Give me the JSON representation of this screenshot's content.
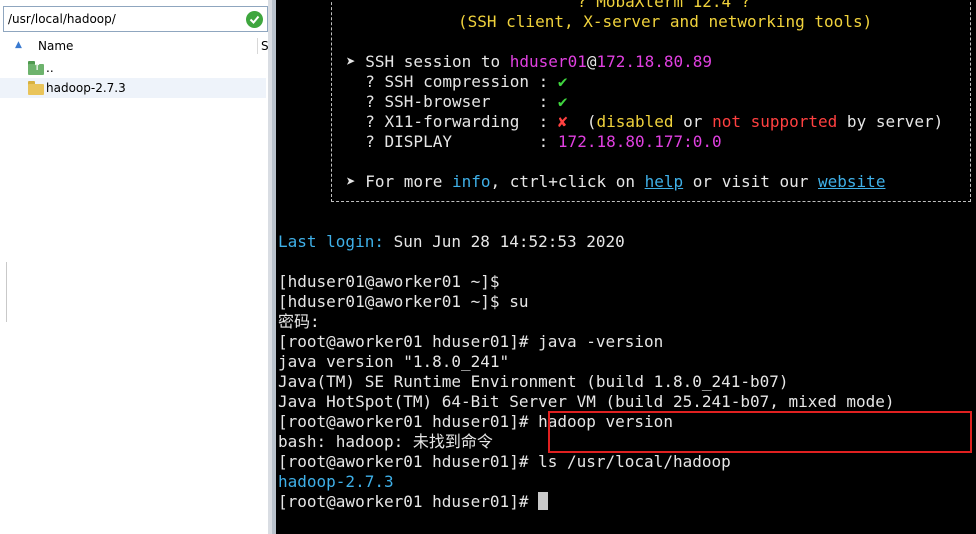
{
  "file_browser": {
    "path": "/usr/local/hadoop/",
    "columns": {
      "name": "Name",
      "size": "S"
    },
    "items": [
      {
        "name": "..",
        "icon": "parent-folder-icon"
      },
      {
        "name": "hadoop-2.7.3",
        "icon": "folder-icon"
      }
    ]
  },
  "terminal": {
    "banner": {
      "title": "? MobaXterm 12.4 ?",
      "subtitle": "(SSH client, X-server and networking tools)",
      "ssh_session_prefix": "➤ SSH session to ",
      "ssh_user": "hduser01",
      "ssh_at": "@",
      "ssh_host": "172.18.80.89",
      "compression_label": "  ? SSH compression : ",
      "compression_value": "✔",
      "browser_label": "  ? SSH-browser     : ",
      "browser_value": "✔",
      "x11_label": "  ? X11-forwarding  : ",
      "x11_value": "✘",
      "x11_note_open": "  (",
      "x11_note_disabled": "disabled",
      "x11_note_or": " or ",
      "x11_note_not_supported": "not supported",
      "x11_note_close": " by server)",
      "display_label": "  ? DISPLAY         : ",
      "display_value": "172.18.80.177:0.0",
      "more_prefix": "➤ For more ",
      "more_info": "info",
      "more_mid": ", ctrl+click on ",
      "more_help": "help",
      "more_or": " or visit our ",
      "more_website": "website"
    },
    "last_login_label": "Last login:",
    "last_login_value": " Sun Jun 28 14:52:53 2020",
    "lines": [
      "[hduser01@aworker01 ~]$",
      "[hduser01@aworker01 ~]$ su",
      "密码:",
      "[root@aworker01 hduser01]# java -version",
      "java version \"1.8.0_241\"",
      "Java(TM) SE Runtime Environment (build 1.8.0_241-b07)",
      "Java HotSpot(TM) 64-Bit Server VM (build 25.241-b07, mixed mode)",
      "[root@aworker01 hduser01]# hadoop version",
      "bash: hadoop: 未找到命令",
      "[root@aworker01 hduser01]# ls /usr/local/hadoop"
    ],
    "ls_output": "hadoop-2.7.3",
    "prompt": "[root@aworker01 hduser01]# "
  },
  "colors": {
    "terminal_bg": "#000000",
    "highlight_box": "#e02020",
    "banner_yellow": "#f0d23c",
    "magenta": "#e040e0",
    "cyan": "#3fb0e8"
  }
}
